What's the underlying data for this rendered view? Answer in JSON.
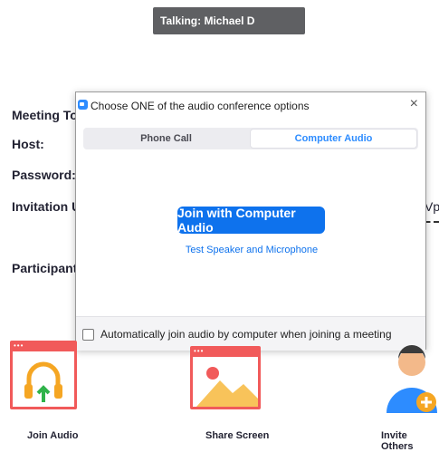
{
  "toast": {
    "talking": "Talking: Michael D"
  },
  "meeting_info": {
    "topic_label": "Meeting Topi",
    "host_label": "Host:",
    "password_label": "Password:",
    "invitation_label": "Invitation UR",
    "participant_label": "Participant ID",
    "url_fragment": "Vp"
  },
  "dialog": {
    "title": "Choose ONE of the audio conference options",
    "close": "×",
    "tabs": [
      {
        "label": "Phone Call",
        "active": false
      },
      {
        "label": "Computer Audio",
        "active": true
      }
    ],
    "join_button": "Join with Computer Audio",
    "test_link": "Test Speaker and Microphone",
    "auto_join_label": "Automatically join audio by computer when joining a meeting",
    "auto_join_checked": false
  },
  "actions": [
    {
      "label": "Join Audio",
      "icon": "headphones-icon"
    },
    {
      "label": "Share Screen",
      "icon": "share-screen-icon"
    },
    {
      "label": "Invite Others",
      "icon": "invite-user-icon"
    }
  ],
  "colors": {
    "accent": "#0e72ed",
    "tile_red": "#f15a5a",
    "toast_bg": "#5f6063"
  }
}
